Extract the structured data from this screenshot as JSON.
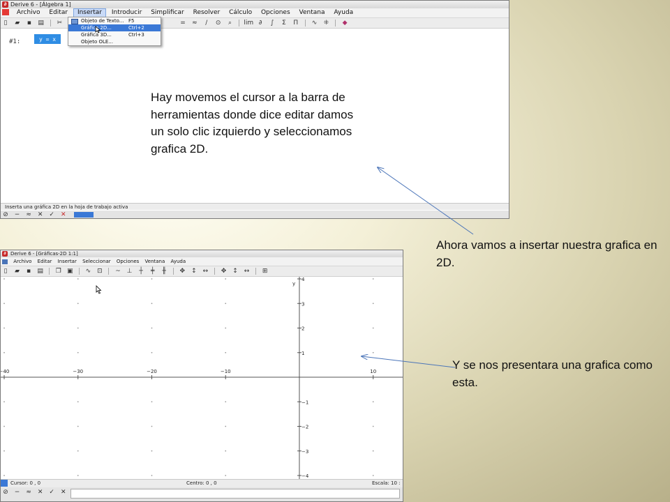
{
  "top_window": {
    "title": "Derive 6 - [Álgebra 1]",
    "menu": [
      "Archivo",
      "Editar",
      "Insertar",
      "Introducir",
      "Simplificar",
      "Resolver",
      "Cálculo",
      "Opciones",
      "Ventana",
      "Ayuda"
    ],
    "active_menu": "Insertar",
    "expression_label": "#1:",
    "expression_value": "y = x",
    "dropdown_items": [
      {
        "label": "Objeto de Texto...",
        "shortcut": "F5"
      },
      {
        "label": "Gráfica 2D...",
        "shortcut": "Ctrl+2"
      },
      {
        "label": "Gráfica 3D...",
        "shortcut": "Ctrl+3"
      },
      {
        "label": "Objeto OLE...",
        "shortcut": ""
      }
    ],
    "highlighted_item": "Gráfica 2D...",
    "status_text": "Inserta una gráfica 2D en la hoja de trabajo activa"
  },
  "bottom_window": {
    "title": "Derive 6 - [Gráficas-2D 1:1]",
    "menu": [
      "Archivo",
      "Editar",
      "Insertar",
      "Seleccionar",
      "Opciones",
      "Ventana",
      "Ayuda"
    ],
    "status": {
      "cursor": "Cursor: 0 , 0",
      "center": "Centro: 0 , 0",
      "scale": "Escala: 10 : 1"
    }
  },
  "chart_data": {
    "type": "scatter",
    "xlabel": "",
    "ylabel": "y",
    "xlim": [
      -40,
      14
    ],
    "ylim": [
      -4,
      4
    ],
    "x_ticks": [
      -40,
      -30,
      -20,
      -10,
      10
    ],
    "y_ticks": [
      4,
      3,
      2,
      1,
      -1,
      -2,
      -3,
      -4
    ],
    "grid": "dots",
    "series": []
  },
  "annotations": {
    "top": "Hay movemos el cursor a la barra de herramientas donde dice editar damos un solo clic izquierdo y seleccionamos grafica 2D.",
    "right": "Ahora vamos a insertar nuestra grafica en 2D.",
    "bottom": "Y se nos presentara una grafica como esta."
  },
  "colors": {
    "arrow": "#4a74b8",
    "selection": "#3a78d6",
    "grid_dot": "#9a9a9a"
  }
}
